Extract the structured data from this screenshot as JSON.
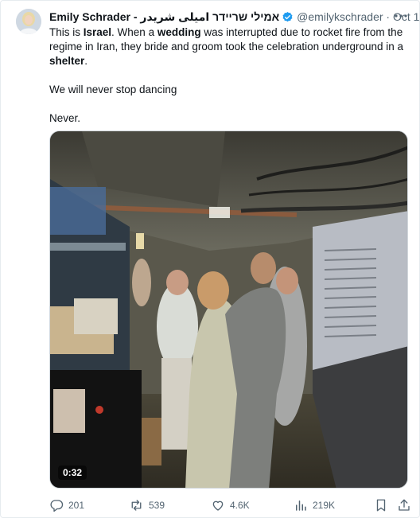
{
  "tweet": {
    "author_name": "Emily Schrader - אמילי שריידר امیلی شریدر",
    "handle": "@emilykschrader",
    "separator": "·",
    "date": "Oct 1",
    "body": {
      "p1_seg1": "This is ",
      "p1_bold1": "Israel",
      "p1_seg2": ". When a ",
      "p1_bold2": "wedding",
      "p1_seg3": " was interrupted due to rocket fire from the regime in Iran, they bride and groom took the celebration underground in a ",
      "p1_bold3": "shelter",
      "p1_seg4": ".",
      "p2": "We will never stop dancing",
      "p3": "Never."
    },
    "video": {
      "duration": "0:32"
    },
    "actions": {
      "replies": "201",
      "reposts": "539",
      "likes": "4.6K",
      "views": "219K"
    },
    "colors": {
      "verified": "#1d9bf0",
      "secondary_text": "#536471"
    },
    "icons": [
      "verified-badge-icon",
      "more-icon",
      "reply-icon",
      "repost-icon",
      "like-icon",
      "views-icon",
      "bookmark-icon",
      "share-icon"
    ]
  }
}
